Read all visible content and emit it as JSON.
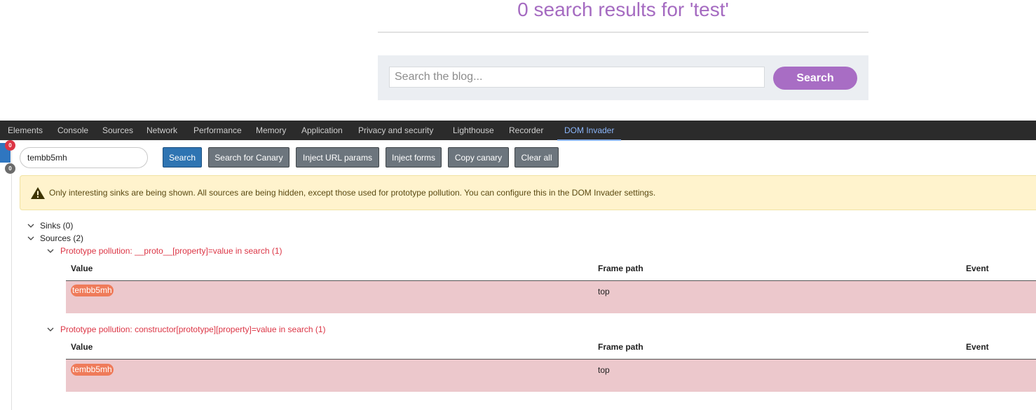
{
  "page": {
    "results_title": "0 search results for 'test'",
    "search_placeholder": "Search the blog...",
    "search_button": "Search"
  },
  "devtools": {
    "tabs": [
      "Elements",
      "Console",
      "Sources",
      "Network",
      "Performance",
      "Memory",
      "Application",
      "Privacy and security",
      "Lighthouse",
      "Recorder",
      "DOM Invader"
    ],
    "active_tab": "DOM Invader",
    "badges": {
      "sinks_count": "0",
      "sources_count": "0"
    },
    "canary_value": "tembb5mh",
    "buttons": {
      "search": "Search",
      "search_canary": "Search for Canary",
      "inject_url": "Inject URL params",
      "inject_forms": "Inject forms",
      "copy_canary": "Copy canary",
      "clear_all": "Clear all"
    },
    "warning_text": "Only interesting sinks are being shown. All sources are being hidden, except those used for prototype pollution. You can configure this in the DOM Invader settings.",
    "sinks_label": "Sinks (0)",
    "sources_label": "Sources (2)",
    "columns": {
      "value": "Value",
      "frame_path": "Frame path",
      "event": "Event"
    },
    "source_groups": [
      {
        "title": "Prototype pollution: __proto__[property]=value in search (1)",
        "rows": [
          {
            "value": "tembb5mh",
            "frame_path": "top",
            "event": ""
          }
        ]
      },
      {
        "title": "Prototype pollution: constructor[prototype][property]=value in search (1)",
        "rows": [
          {
            "value": "tembb5mh",
            "frame_path": "top",
            "event": ""
          }
        ]
      }
    ]
  },
  "colors": {
    "brand_purple": "#a86dc4",
    "devtools_bg": "#2b2b2b",
    "active_tab": "#8ab4f8",
    "primary_button": "#2e74b2",
    "secondary_button": "#6c757d",
    "warning_bg": "#fff3cd",
    "source_red": "#dc3545",
    "row_bg": "#ecc8cc",
    "pill": "#ef7b5a"
  },
  "icons": [
    "warning-icon",
    "chevron-down-icon"
  ]
}
